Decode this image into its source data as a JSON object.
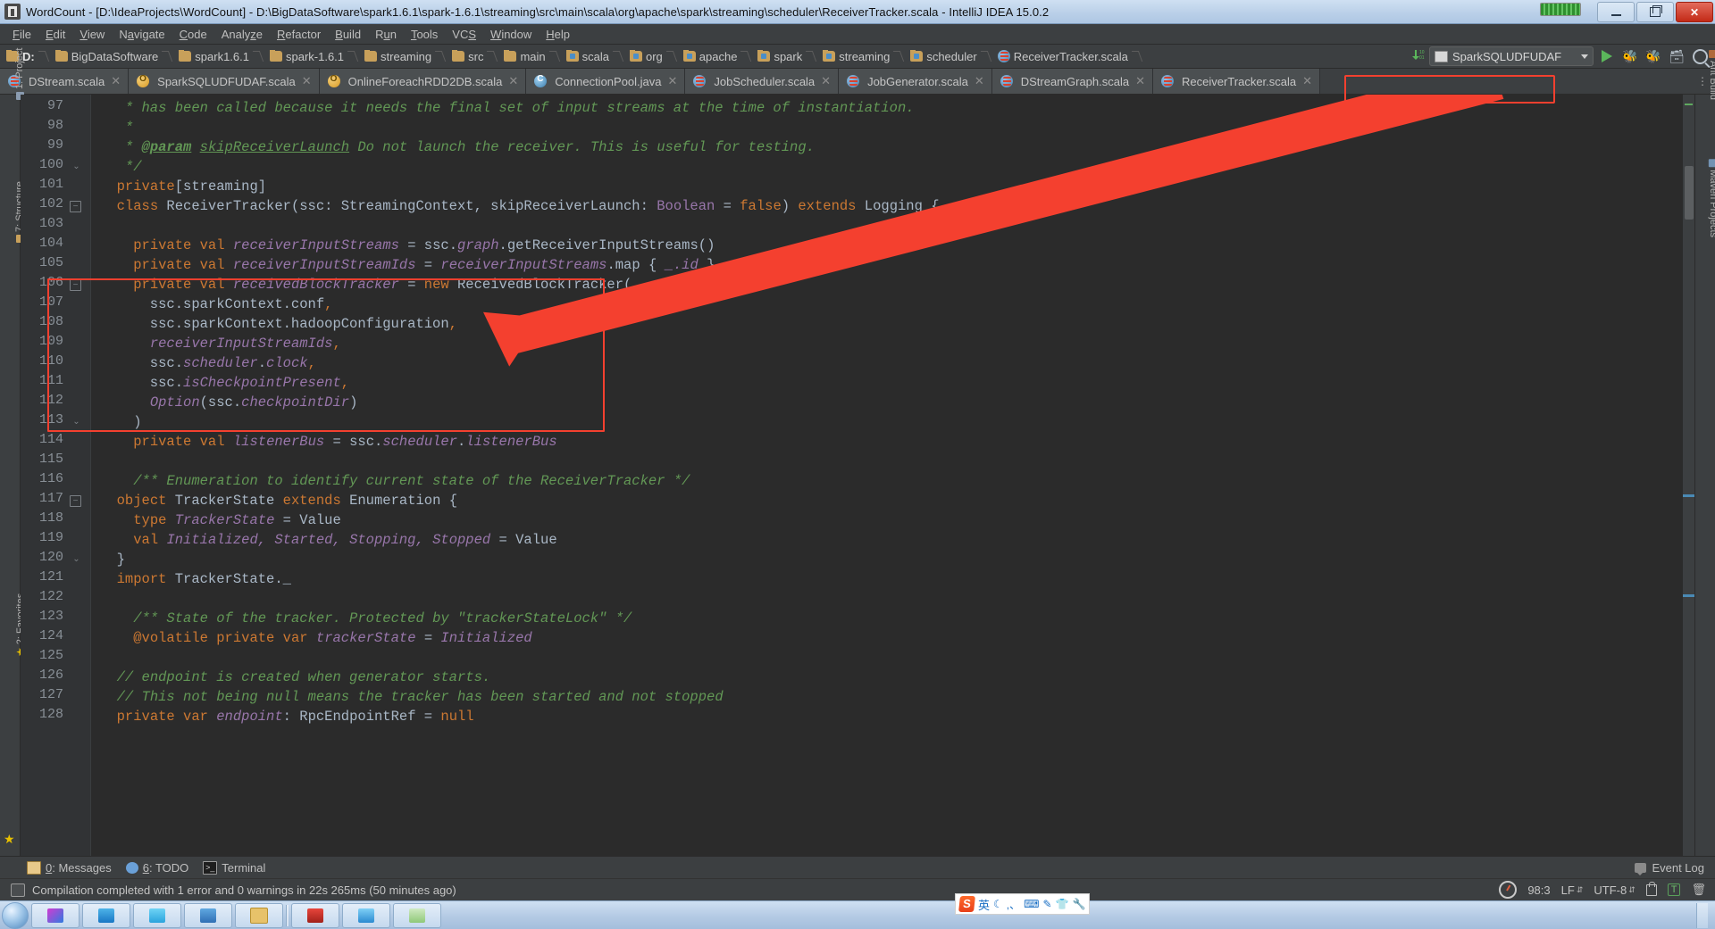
{
  "window": {
    "title": "WordCount - [D:\\IdeaProjects\\WordCount] - D:\\BigDataSoftware\\spark1.6.1\\spark-1.6.1\\streaming\\src\\main\\scala\\org\\apache\\spark\\streaming\\scheduler\\ReceiverTracker.scala - IntelliJ IDEA 15.0.2",
    "minimize_label": "Minimize",
    "restore_label": "Restore",
    "close_label": "✕"
  },
  "menubar": {
    "items": [
      "File",
      "Edit",
      "View",
      "Navigate",
      "Code",
      "Analyze",
      "Refactor",
      "Build",
      "Run",
      "Tools",
      "VCS",
      "Window",
      "Help"
    ]
  },
  "navbar": {
    "breadcrumbs": [
      {
        "label": "D:",
        "icon": "folder-icon",
        "type": "folder",
        "root": true
      },
      {
        "label": "BigDataSoftware",
        "icon": "folder-icon",
        "type": "folder"
      },
      {
        "label": "spark1.6.1",
        "icon": "folder-icon",
        "type": "folder"
      },
      {
        "label": "spark-1.6.1",
        "icon": "folder-icon",
        "type": "folder"
      },
      {
        "label": "streaming",
        "icon": "folder-icon",
        "type": "folder"
      },
      {
        "label": "src",
        "icon": "folder-icon",
        "type": "folder"
      },
      {
        "label": "main",
        "icon": "folder-icon",
        "type": "folder"
      },
      {
        "label": "scala",
        "icon": "source-folder-icon",
        "type": "srcfolder"
      },
      {
        "label": "org",
        "icon": "package-icon",
        "type": "srcfolder"
      },
      {
        "label": "apache",
        "icon": "package-icon",
        "type": "srcfolder"
      },
      {
        "label": "spark",
        "icon": "package-icon",
        "type": "srcfolder"
      },
      {
        "label": "streaming",
        "icon": "package-icon",
        "type": "srcfolder"
      },
      {
        "label": "scheduler",
        "icon": "package-icon",
        "type": "srcfolder"
      },
      {
        "label": "ReceiverTracker.scala",
        "icon": "scala-file-icon",
        "type": "scala"
      }
    ],
    "updates_icon": "download-updates-icon",
    "run_config": {
      "name": "SparkSQLUDFUDAF",
      "icon": "run-config-icon",
      "arrow": "chevron-down-icon"
    },
    "buttons": [
      {
        "name": "run-button",
        "icon": "play-icon"
      },
      {
        "name": "debug-button",
        "icon": "bug-icon"
      },
      {
        "name": "coverage-button",
        "icon": "coverage-icon"
      },
      {
        "name": "layout-button",
        "icon": "layout-icon"
      },
      {
        "name": "search-everywhere-button",
        "icon": "search-icon"
      }
    ]
  },
  "tabs": [
    {
      "label": "DStream.scala",
      "icon": "scala-file-icon",
      "active": false,
      "closable": true
    },
    {
      "label": "SparkSQLUDFUDAF.scala",
      "icon": "scala-object-icon",
      "active": false,
      "closable": true
    },
    {
      "label": "OnlineForeachRDD2DB.scala",
      "icon": "scala-object-icon",
      "active": false,
      "closable": true
    },
    {
      "label": "ConnectionPool.java",
      "icon": "java-class-icon",
      "active": false,
      "closable": true
    },
    {
      "label": "JobScheduler.scala",
      "icon": "scala-file-icon",
      "active": false,
      "closable": true
    },
    {
      "label": "JobGenerator.scala",
      "icon": "scala-file-icon",
      "active": false,
      "closable": true
    },
    {
      "label": "DStreamGraph.scala",
      "icon": "scala-file-icon",
      "active": false,
      "closable": true
    },
    {
      "label": "ReceiverTracker.scala",
      "icon": "scala-file-icon",
      "active": true,
      "closable": true
    }
  ],
  "left_rail": [
    {
      "label": "1: Project",
      "icon": "project-icon"
    },
    {
      "label": "7: Structure",
      "icon": "structure-icon"
    },
    {
      "label": "2: Favorites",
      "icon": "favorites-star-icon"
    }
  ],
  "right_rail": [
    {
      "label": "Ant Build",
      "icon": "ant-icon"
    },
    {
      "label": "Maven Projects",
      "icon": "maven-icon"
    }
  ],
  "editor": {
    "first_line": 97,
    "lines": [
      {
        "n": 97,
        "segments": [
          {
            "t": "   * has been called because it needs the final set of input streams at the time of instantiation.",
            "c": "c"
          }
        ]
      },
      {
        "n": 98,
        "segments": [
          {
            "t": "   *",
            "c": "c"
          }
        ]
      },
      {
        "n": 99,
        "segments": [
          {
            "t": "   * ",
            "c": "c"
          },
          {
            "t": "@param",
            "c": "ctag"
          },
          {
            "t": " ",
            "c": "c"
          },
          {
            "t": "skipReceiverLaunch",
            "c": "cref"
          },
          {
            "t": " Do not launch the receiver. This is useful for testing.",
            "c": "c"
          }
        ]
      },
      {
        "n": 100,
        "segments": [
          {
            "t": "   */",
            "c": "c"
          }
        ],
        "fold": "end"
      },
      {
        "n": 101,
        "segments": [
          {
            "t": "  ",
            "c": "t"
          },
          {
            "t": "private",
            "c": "k"
          },
          {
            "t": "[streaming]",
            "c": "t"
          }
        ]
      },
      {
        "n": 102,
        "segments": [
          {
            "t": "  ",
            "c": "t"
          },
          {
            "t": "class",
            "c": "k"
          },
          {
            "t": " ReceiverTracker(ssc: StreamingContext, skipReceiverLaunch: ",
            "c": "t"
          },
          {
            "t": "Boolean",
            "c": "fm"
          },
          {
            "t": " = ",
            "c": "t"
          },
          {
            "t": "false",
            "c": "k"
          },
          {
            "t": ") ",
            "c": "t"
          },
          {
            "t": "extends",
            "c": "k"
          },
          {
            "t": " Logging {",
            "c": "t"
          }
        ],
        "fold": "start"
      },
      {
        "n": 103,
        "segments": [
          {
            "t": "",
            "c": "t"
          }
        ]
      },
      {
        "n": 104,
        "segments": [
          {
            "t": "    ",
            "c": "t"
          },
          {
            "t": "private val",
            "c": "k"
          },
          {
            "t": " ",
            "c": "t"
          },
          {
            "t": "receiverInputStreams",
            "c": "f"
          },
          {
            "t": " = ssc.",
            "c": "t"
          },
          {
            "t": "graph",
            "c": "f"
          },
          {
            "t": ".getReceiverInputStreams()",
            "c": "t"
          }
        ]
      },
      {
        "n": 105,
        "segments": [
          {
            "t": "    ",
            "c": "t"
          },
          {
            "t": "private val",
            "c": "k"
          },
          {
            "t": " ",
            "c": "t"
          },
          {
            "t": "receiverInputStreamIds",
            "c": "f"
          },
          {
            "t": " = ",
            "c": "t"
          },
          {
            "t": "receiverInputStreams",
            "c": "f"
          },
          {
            "t": ".map { ",
            "c": "t"
          },
          {
            "t": "_.id",
            "c": "f"
          },
          {
            "t": " }",
            "c": "t"
          }
        ]
      },
      {
        "n": 106,
        "segments": [
          {
            "t": "    ",
            "c": "t"
          },
          {
            "t": "private val",
            "c": "k"
          },
          {
            "t": " ",
            "c": "t"
          },
          {
            "t": "receivedBlockTracker",
            "c": "f"
          },
          {
            "t": " = ",
            "c": "t"
          },
          {
            "t": "new",
            "c": "k"
          },
          {
            "t": " ReceivedBlockTracker(",
            "c": "t"
          }
        ],
        "fold": "start"
      },
      {
        "n": 107,
        "segments": [
          {
            "t": "      ssc.sparkContext.conf",
            "c": "t"
          },
          {
            "t": ",",
            "c": "k"
          }
        ]
      },
      {
        "n": 108,
        "segments": [
          {
            "t": "      ssc.sparkContext.hadoopConfiguration",
            "c": "t"
          },
          {
            "t": ",",
            "c": "k"
          }
        ]
      },
      {
        "n": 109,
        "segments": [
          {
            "t": "      ",
            "c": "t"
          },
          {
            "t": "receiverInputStreamIds",
            "c": "f"
          },
          {
            "t": ",",
            "c": "k"
          }
        ]
      },
      {
        "n": 110,
        "segments": [
          {
            "t": "      ssc.",
            "c": "t"
          },
          {
            "t": "scheduler",
            "c": "f"
          },
          {
            "t": ".",
            "c": "t"
          },
          {
            "t": "clock",
            "c": "f"
          },
          {
            "t": ",",
            "c": "k"
          }
        ]
      },
      {
        "n": 111,
        "segments": [
          {
            "t": "      ssc.",
            "c": "t"
          },
          {
            "t": "isCheckpointPresent",
            "c": "f"
          },
          {
            "t": ",",
            "c": "k"
          }
        ]
      },
      {
        "n": 112,
        "segments": [
          {
            "t": "      ",
            "c": "t"
          },
          {
            "t": "Option",
            "c": "f"
          },
          {
            "t": "(ssc.",
            "c": "t"
          },
          {
            "t": "checkpointDir",
            "c": "f"
          },
          {
            "t": ")",
            "c": "t"
          }
        ]
      },
      {
        "n": 113,
        "segments": [
          {
            "t": "    )",
            "c": "t"
          }
        ],
        "fold": "end"
      },
      {
        "n": 114,
        "segments": [
          {
            "t": "    ",
            "c": "t"
          },
          {
            "t": "private val",
            "c": "k"
          },
          {
            "t": " ",
            "c": "t"
          },
          {
            "t": "listenerBus",
            "c": "f"
          },
          {
            "t": " = ssc.",
            "c": "t"
          },
          {
            "t": "scheduler",
            "c": "f"
          },
          {
            "t": ".",
            "c": "t"
          },
          {
            "t": "listenerBus",
            "c": "f"
          }
        ]
      },
      {
        "n": 115,
        "segments": [
          {
            "t": "",
            "c": "t"
          }
        ]
      },
      {
        "n": 116,
        "segments": [
          {
            "t": "    ",
            "c": "t"
          },
          {
            "t": "/** Enumeration to identify current state of the ReceiverTracker */",
            "c": "c"
          }
        ]
      },
      {
        "n": 117,
        "segments": [
          {
            "t": "  ",
            "c": "t"
          },
          {
            "t": "object",
            "c": "k"
          },
          {
            "t": " TrackerState ",
            "c": "t"
          },
          {
            "t": "extends",
            "c": "k"
          },
          {
            "t": " Enumeration {",
            "c": "t"
          }
        ],
        "fold": "start"
      },
      {
        "n": 118,
        "segments": [
          {
            "t": "    ",
            "c": "t"
          },
          {
            "t": "type",
            "c": "k"
          },
          {
            "t": " ",
            "c": "t"
          },
          {
            "t": "TrackerState",
            "c": "f"
          },
          {
            "t": " = Value",
            "c": "t"
          }
        ]
      },
      {
        "n": 119,
        "segments": [
          {
            "t": "    ",
            "c": "t"
          },
          {
            "t": "val",
            "c": "k"
          },
          {
            "t": " ",
            "c": "t"
          },
          {
            "t": "Initialized, Started, Stopping, Stopped",
            "c": "f"
          },
          {
            "t": " = Value",
            "c": "t"
          }
        ]
      },
      {
        "n": 120,
        "segments": [
          {
            "t": "  }",
            "c": "t"
          }
        ],
        "fold": "end"
      },
      {
        "n": 121,
        "segments": [
          {
            "t": "  ",
            "c": "t"
          },
          {
            "t": "import",
            "c": "k"
          },
          {
            "t": " TrackerState._",
            "c": "t"
          }
        ]
      },
      {
        "n": 122,
        "segments": [
          {
            "t": "",
            "c": "t"
          }
        ]
      },
      {
        "n": 123,
        "segments": [
          {
            "t": "    ",
            "c": "t"
          },
          {
            "t": "/** State of the tracker. Protected by \"trackerStateLock\" */",
            "c": "c"
          }
        ]
      },
      {
        "n": 124,
        "segments": [
          {
            "t": "    ",
            "c": "t"
          },
          {
            "t": "@volatile",
            "c": "k"
          },
          {
            "t": " ",
            "c": "t"
          },
          {
            "t": "private var",
            "c": "k"
          },
          {
            "t": " ",
            "c": "t"
          },
          {
            "t": "trackerState",
            "c": "f"
          },
          {
            "t": " = ",
            "c": "t"
          },
          {
            "t": "Initialized",
            "c": "f"
          }
        ]
      },
      {
        "n": 125,
        "segments": [
          {
            "t": "",
            "c": "t"
          }
        ]
      },
      {
        "n": 126,
        "segments": [
          {
            "t": "  ",
            "c": "t"
          },
          {
            "t": "// endpoint is created when generator starts.",
            "c": "c"
          }
        ]
      },
      {
        "n": 127,
        "segments": [
          {
            "t": "  ",
            "c": "t"
          },
          {
            "t": "// This not being null means the tracker has been started and not stopped",
            "c": "c"
          }
        ]
      },
      {
        "n": 128,
        "segments": [
          {
            "t": "  ",
            "c": "t"
          },
          {
            "t": "private var",
            "c": "k"
          },
          {
            "t": " ",
            "c": "t"
          },
          {
            "t": "endpoint",
            "c": "f"
          },
          {
            "t": ": RpcEndpointRef = ",
            "c": "t"
          },
          {
            "t": "null",
            "c": "k"
          }
        ]
      }
    ],
    "annotation": {
      "type": "red-rectangle-with-arrow",
      "color": "#f4402f",
      "highlight_lines": [
        106,
        113
      ],
      "arrow_target_tab": "ReceiverTracker.scala"
    }
  },
  "bottom_toolwindows": [
    {
      "num": "0",
      "label": ": Messages",
      "icon": "messages-icon"
    },
    {
      "num": "6",
      "label": ": TODO",
      "icon": "todo-icon"
    },
    {
      "num": "",
      "label": "Terminal",
      "icon": "terminal-icon"
    }
  ],
  "event_log": {
    "label": "Event Log",
    "icon": "event-log-icon"
  },
  "statusbar": {
    "message": "Compilation completed with 1 error and 0 warnings in 22s 265ms (50 minutes ago)",
    "icon": "compile-status-icon",
    "caret_position": "98:3",
    "line_separator": "LF",
    "encoding": "UTF-8",
    "lock_icon": "read-write-lock-icon",
    "translate_badge": "T",
    "trash_icon": "memory-trash-icon",
    "gauge_icon": "inspection-gauge-icon"
  },
  "ime_toolbar": {
    "logo": "S",
    "mode": "英",
    "items": [
      "moon-icon",
      "comma-icon",
      "keyboard-icon",
      "handwrite-icon",
      "skin-icon",
      "tools-icon"
    ]
  },
  "taskbar": {
    "start_label": "Start",
    "items": [
      {
        "name": "taskbar-item-1",
        "color": "g1"
      },
      {
        "name": "taskbar-item-2",
        "color": "g2"
      },
      {
        "name": "taskbar-item-3",
        "color": "g3"
      },
      {
        "name": "taskbar-item-4",
        "color": "g4"
      },
      {
        "name": "taskbar-item-5",
        "color": "g5"
      },
      {
        "name": "taskbar-item-6",
        "color": "g6"
      },
      {
        "name": "taskbar-item-7",
        "color": "g7"
      },
      {
        "name": "taskbar-item-8",
        "color": "g8"
      }
    ]
  },
  "colors": {
    "accent_red": "#f4402f",
    "editor_bg": "#2b2b2b",
    "chrome_bg": "#3c3f41",
    "keyword": "#cc7832",
    "field": "#9876aa",
    "comment": "#629755",
    "text": "#a9b7c6"
  }
}
